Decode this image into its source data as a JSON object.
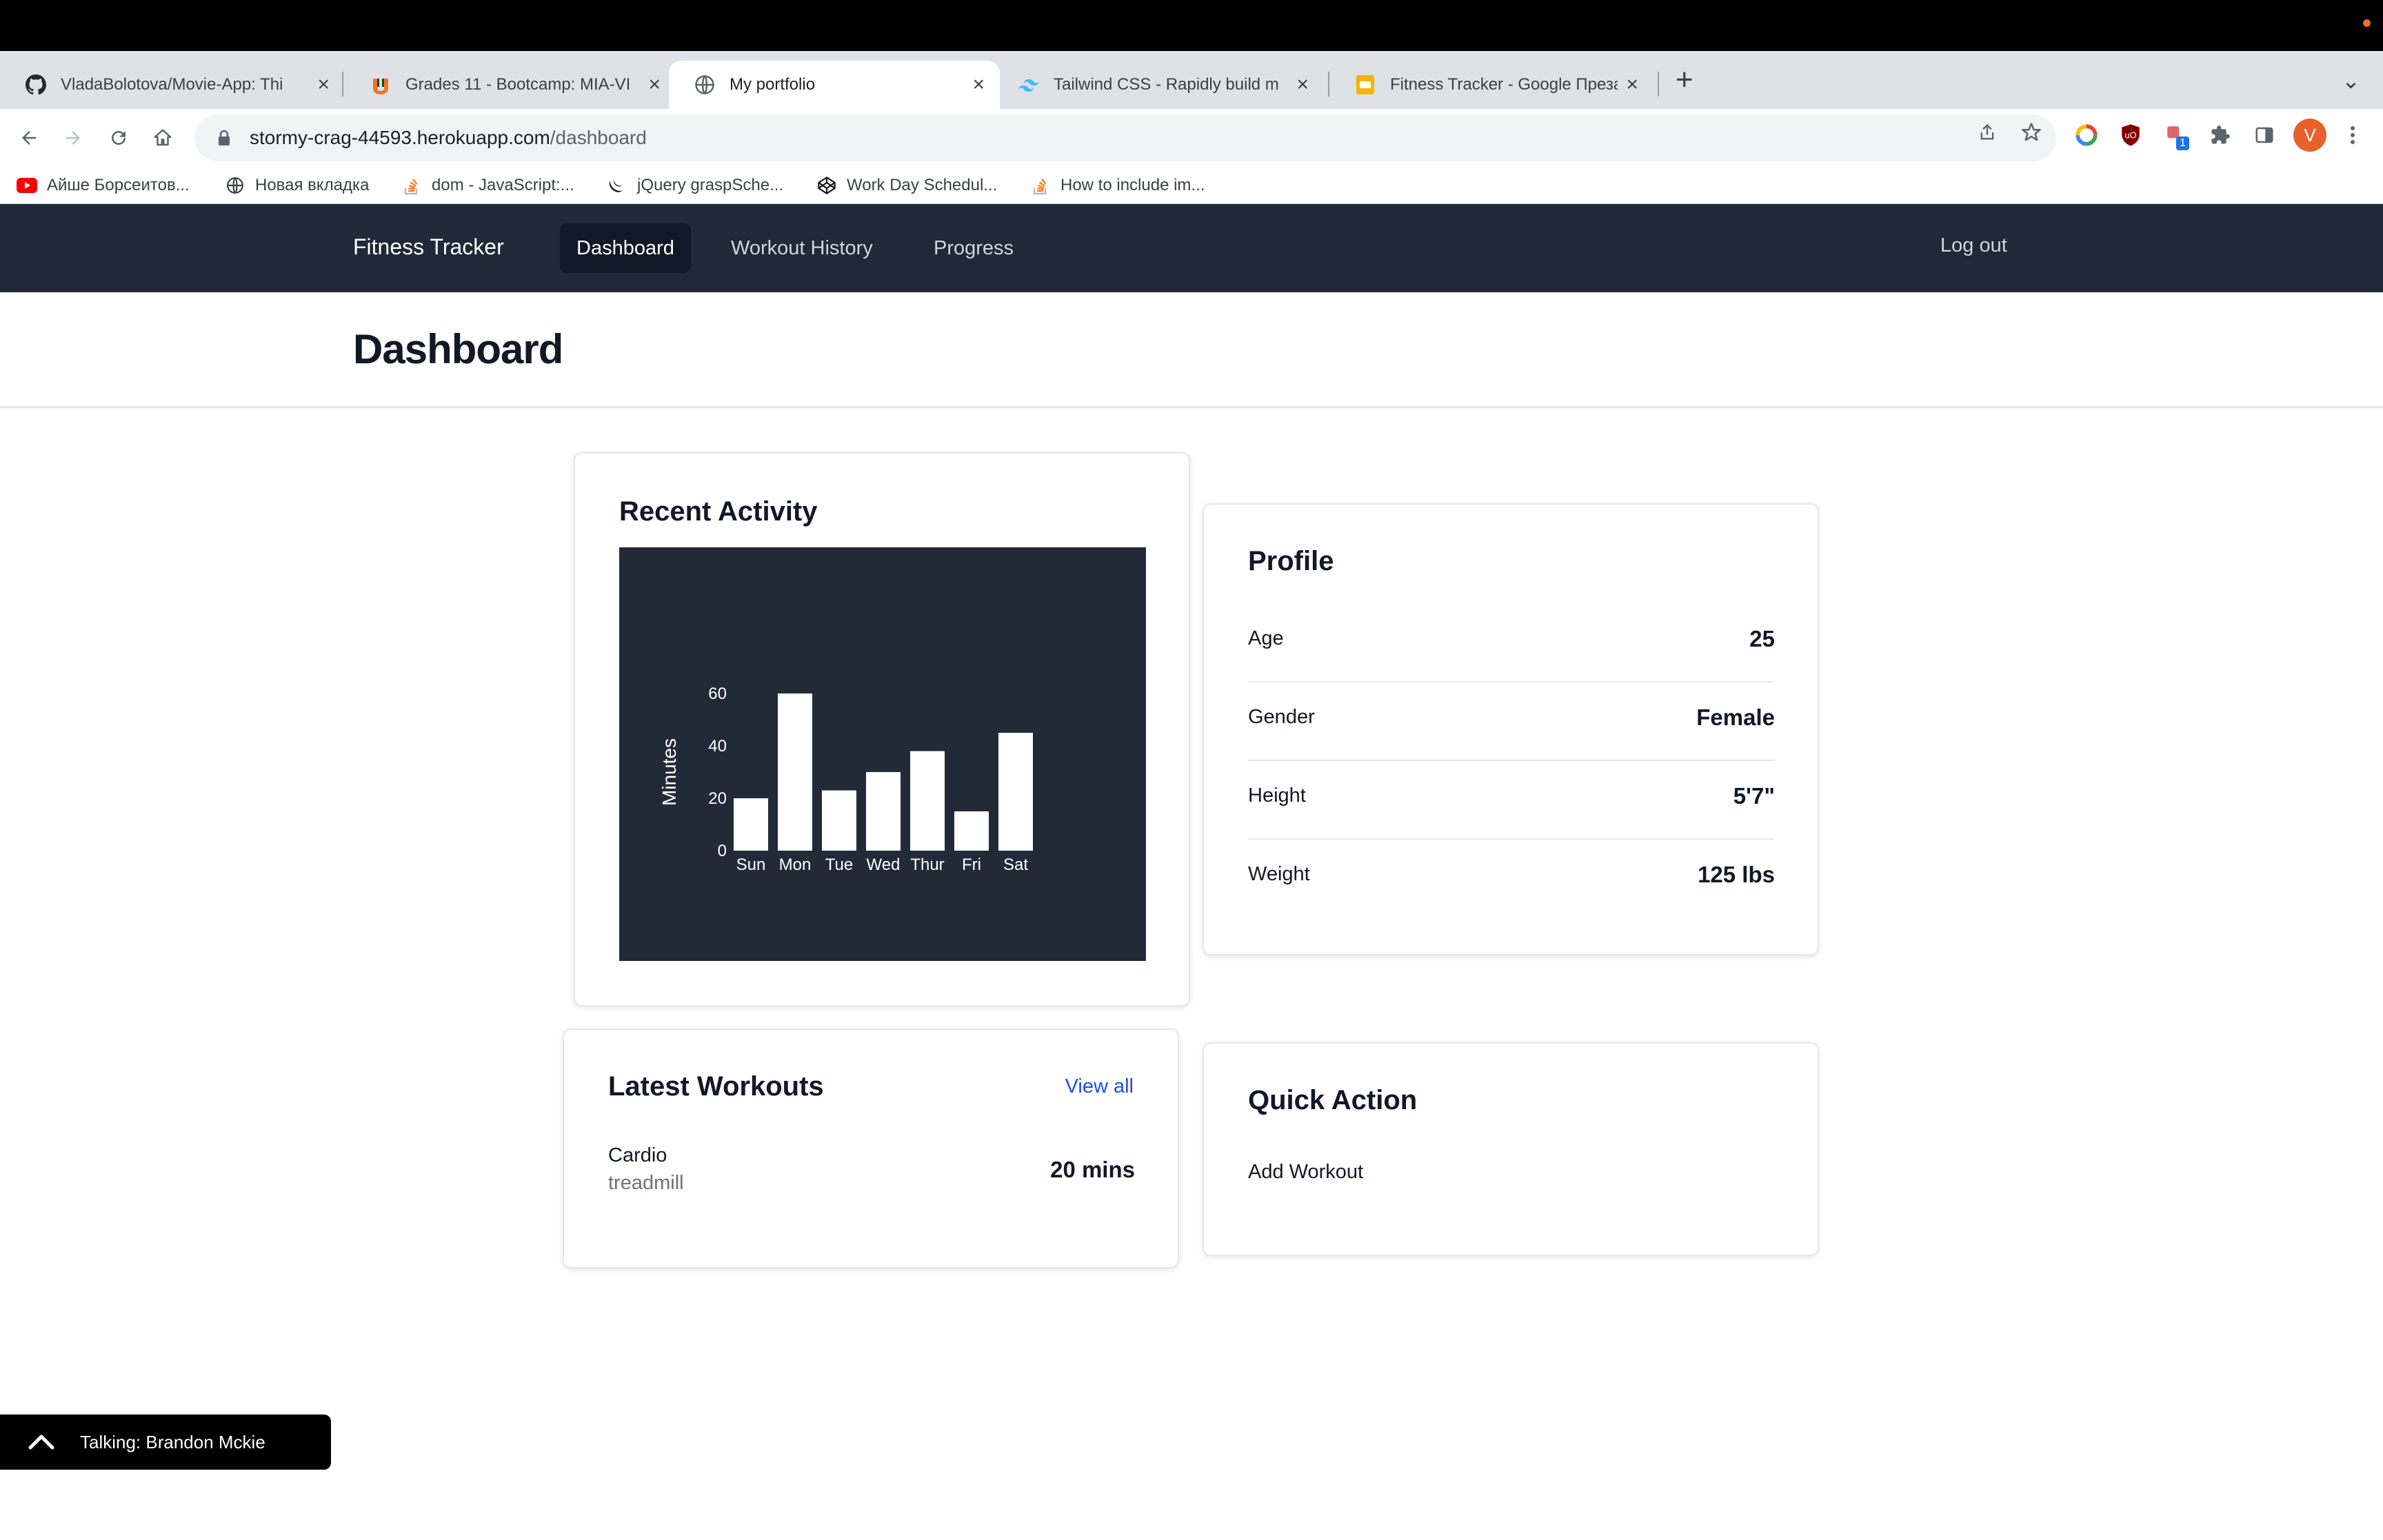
{
  "browser": {
    "tabs": [
      {
        "title": "VladaBolotova/Movie-App: Thi",
        "icon": "github-icon"
      },
      {
        "title": "Grades 11 - Bootcamp: MIA-VI",
        "icon": "canvas-icon"
      },
      {
        "title": "My portfolio",
        "icon": "globe-icon"
      },
      {
        "title": "Tailwind CSS - Rapidly build m",
        "icon": "tailwind-icon"
      },
      {
        "title": "Fitness Tracker - Google Преза",
        "icon": "slides-icon"
      }
    ],
    "url_host": "stormy-crag-44593.herokuapp.com",
    "url_path": "/dashboard",
    "profile_initial": "V",
    "ext_badge": "1",
    "bookmarks": [
      {
        "label": "Айше Борсеитов...",
        "icon": "youtube-icon"
      },
      {
        "label": "Новая вкладка",
        "icon": "globe-icon"
      },
      {
        "label": "dom - JavaScript:...",
        "icon": "stackoverflow-icon"
      },
      {
        "label": "jQuery graspSche...",
        "icon": "jquery-icon"
      },
      {
        "label": "Work Day Schedul...",
        "icon": "codepen-icon"
      },
      {
        "label": "How to include im...",
        "icon": "stackoverflow-icon"
      }
    ]
  },
  "app": {
    "brand": "Fitness Tracker",
    "nav": [
      "Dashboard",
      "Workout History",
      "Progress"
    ],
    "logout": "Log out",
    "page_title": "Dashboard"
  },
  "recent_activity": {
    "title": "Recent Activity"
  },
  "chart_data": {
    "type": "bar",
    "categories": [
      "Sun",
      "Mon",
      "Tue",
      "Wed",
      "Thur",
      "Fri",
      "Sat"
    ],
    "values": [
      20,
      60,
      23,
      30,
      38,
      15,
      45
    ],
    "ylabel": "Minutes",
    "xlabel": "",
    "ylim": [
      0,
      60
    ],
    "yticks": [
      0,
      20,
      40,
      60
    ],
    "bar_color": "#ffffff",
    "background": "#232a37"
  },
  "profile": {
    "title": "Profile",
    "rows": [
      {
        "label": "Age",
        "value": "25"
      },
      {
        "label": "Gender",
        "value": "Female"
      },
      {
        "label": "Height",
        "value": "5'7\""
      },
      {
        "label": "Weight",
        "value": "125 lbs"
      }
    ]
  },
  "latest_workouts": {
    "title": "Latest Workouts",
    "view_all": "View all",
    "items": [
      {
        "type": "Cardio",
        "name": "treadmill",
        "duration": "20 mins"
      }
    ]
  },
  "quick_action": {
    "title": "Quick Action",
    "action": "Add Workout"
  },
  "talking": {
    "text": "Talking: Brandon Mckie"
  },
  "colors": {
    "accent_link": "#1d4ed8",
    "nav_bg": "#1f2937",
    "nav_active": "#111827"
  }
}
